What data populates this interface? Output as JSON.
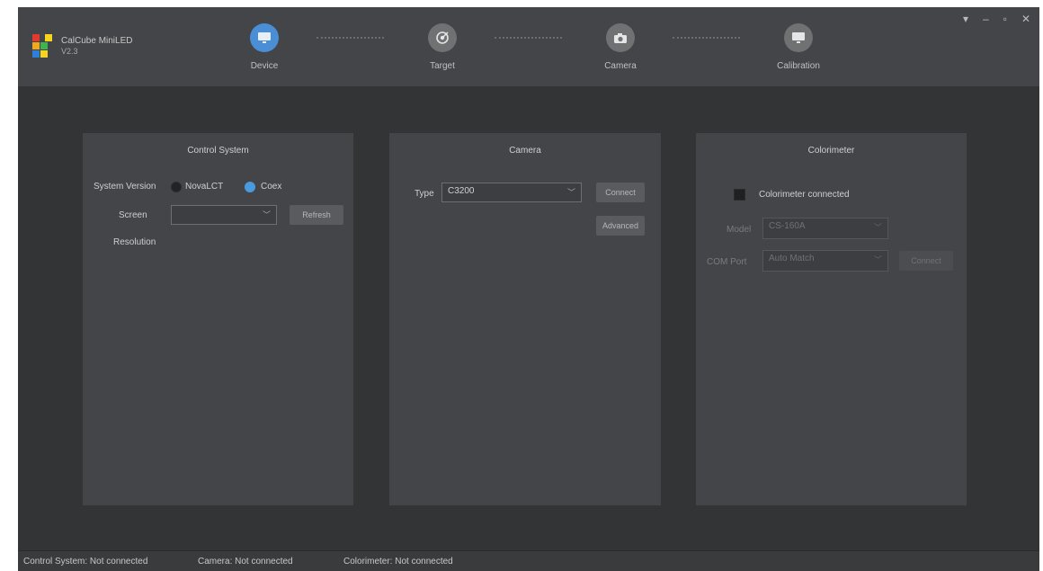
{
  "app": {
    "name": "CalCube MiniLED",
    "version": "V2.3"
  },
  "steps": [
    {
      "label": "Device",
      "icon": "monitor-icon",
      "active": true
    },
    {
      "label": "Target",
      "icon": "target-icon",
      "active": false
    },
    {
      "label": "Camera",
      "icon": "camera-icon",
      "active": false
    },
    {
      "label": "Calibration",
      "icon": "display-icon",
      "active": false
    }
  ],
  "window_controls": {
    "menu": "▾",
    "minimize": "–",
    "maximize": "▫",
    "close": "✕"
  },
  "control_system": {
    "title": "Control System",
    "system_version_label": "System Version",
    "options": [
      "NovaLCT",
      "Coex"
    ],
    "selected": "Coex",
    "screen_label": "Screen",
    "screen_value": "",
    "refresh_label": "Refresh",
    "resolution_label": "Resolution"
  },
  "camera": {
    "title": "Camera",
    "type_label": "Type",
    "type_value": "C3200",
    "connect_label": "Connect",
    "advanced_label": "Advanced"
  },
  "colorimeter": {
    "title": "Colorimeter",
    "checkbox_label": "Colorimeter connected",
    "model_label": "Model",
    "model_value": "CS-160A",
    "com_port_label": "COM Port",
    "com_port_value": "Auto Match",
    "connect_label": "Connect"
  },
  "status": {
    "control_system": "Control System:  Not connected",
    "camera": "Camera:  Not connected",
    "colorimeter": "Colorimeter:  Not connected"
  },
  "colors": {
    "accent": "#4a8fd6",
    "background": "#333436",
    "panel": "#444548"
  }
}
